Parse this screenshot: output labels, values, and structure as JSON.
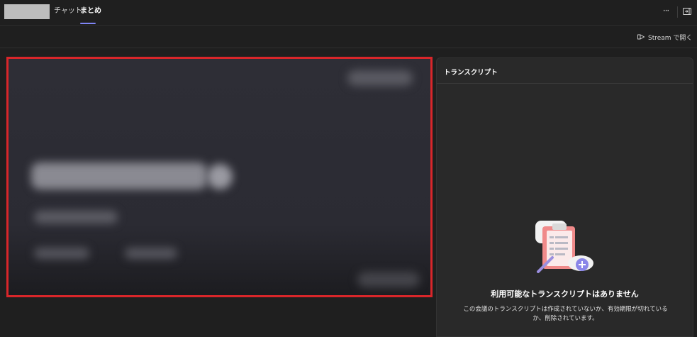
{
  "header": {
    "tabs": [
      {
        "label": "チャット",
        "active": false
      },
      {
        "label": "まとめ",
        "active": true
      }
    ],
    "more_label": "···",
    "accent_color": "#7f85f5"
  },
  "toolbar": {
    "open_in_stream_label": "Stream で開く",
    "open_in_stream_icon": "stream-open-icon"
  },
  "recording": {
    "highlight_color": "#d9262a"
  },
  "transcript": {
    "title": "トランスクリプト",
    "empty_title": "利用可能なトランスクリプトはありません",
    "empty_description": "この会議のトランスクリプトは作成されていないか、有効期限が切れているか、削除されています。",
    "empty_icon": "clipboard-add-icon"
  }
}
